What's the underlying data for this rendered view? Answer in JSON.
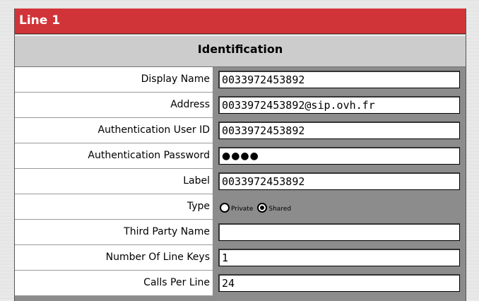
{
  "title": "Line 1",
  "section": "Identification",
  "fields": [
    {
      "label": "Display Name",
      "value": "0033972453892"
    },
    {
      "label": "Address",
      "value": "0033972453892@sip.ovh.fr"
    },
    {
      "label": "Authentication User ID",
      "value": "0033972453892"
    },
    {
      "label": "Authentication Password",
      "value": "●●●●"
    },
    {
      "label": "Label",
      "value": "0033972453892"
    },
    {
      "label": "Type",
      "options": [
        "Private",
        "Shared"
      ],
      "selected": "Shared"
    },
    {
      "label": "Third Party Name",
      "value": ""
    },
    {
      "label": "Number Of Line Keys",
      "value": "1"
    },
    {
      "label": "Calls Per Line",
      "value": "24"
    }
  ],
  "colors": {
    "title_bg": "#d13438",
    "section_bg": "#cccccc",
    "field_bg": "#8c8c8c"
  }
}
